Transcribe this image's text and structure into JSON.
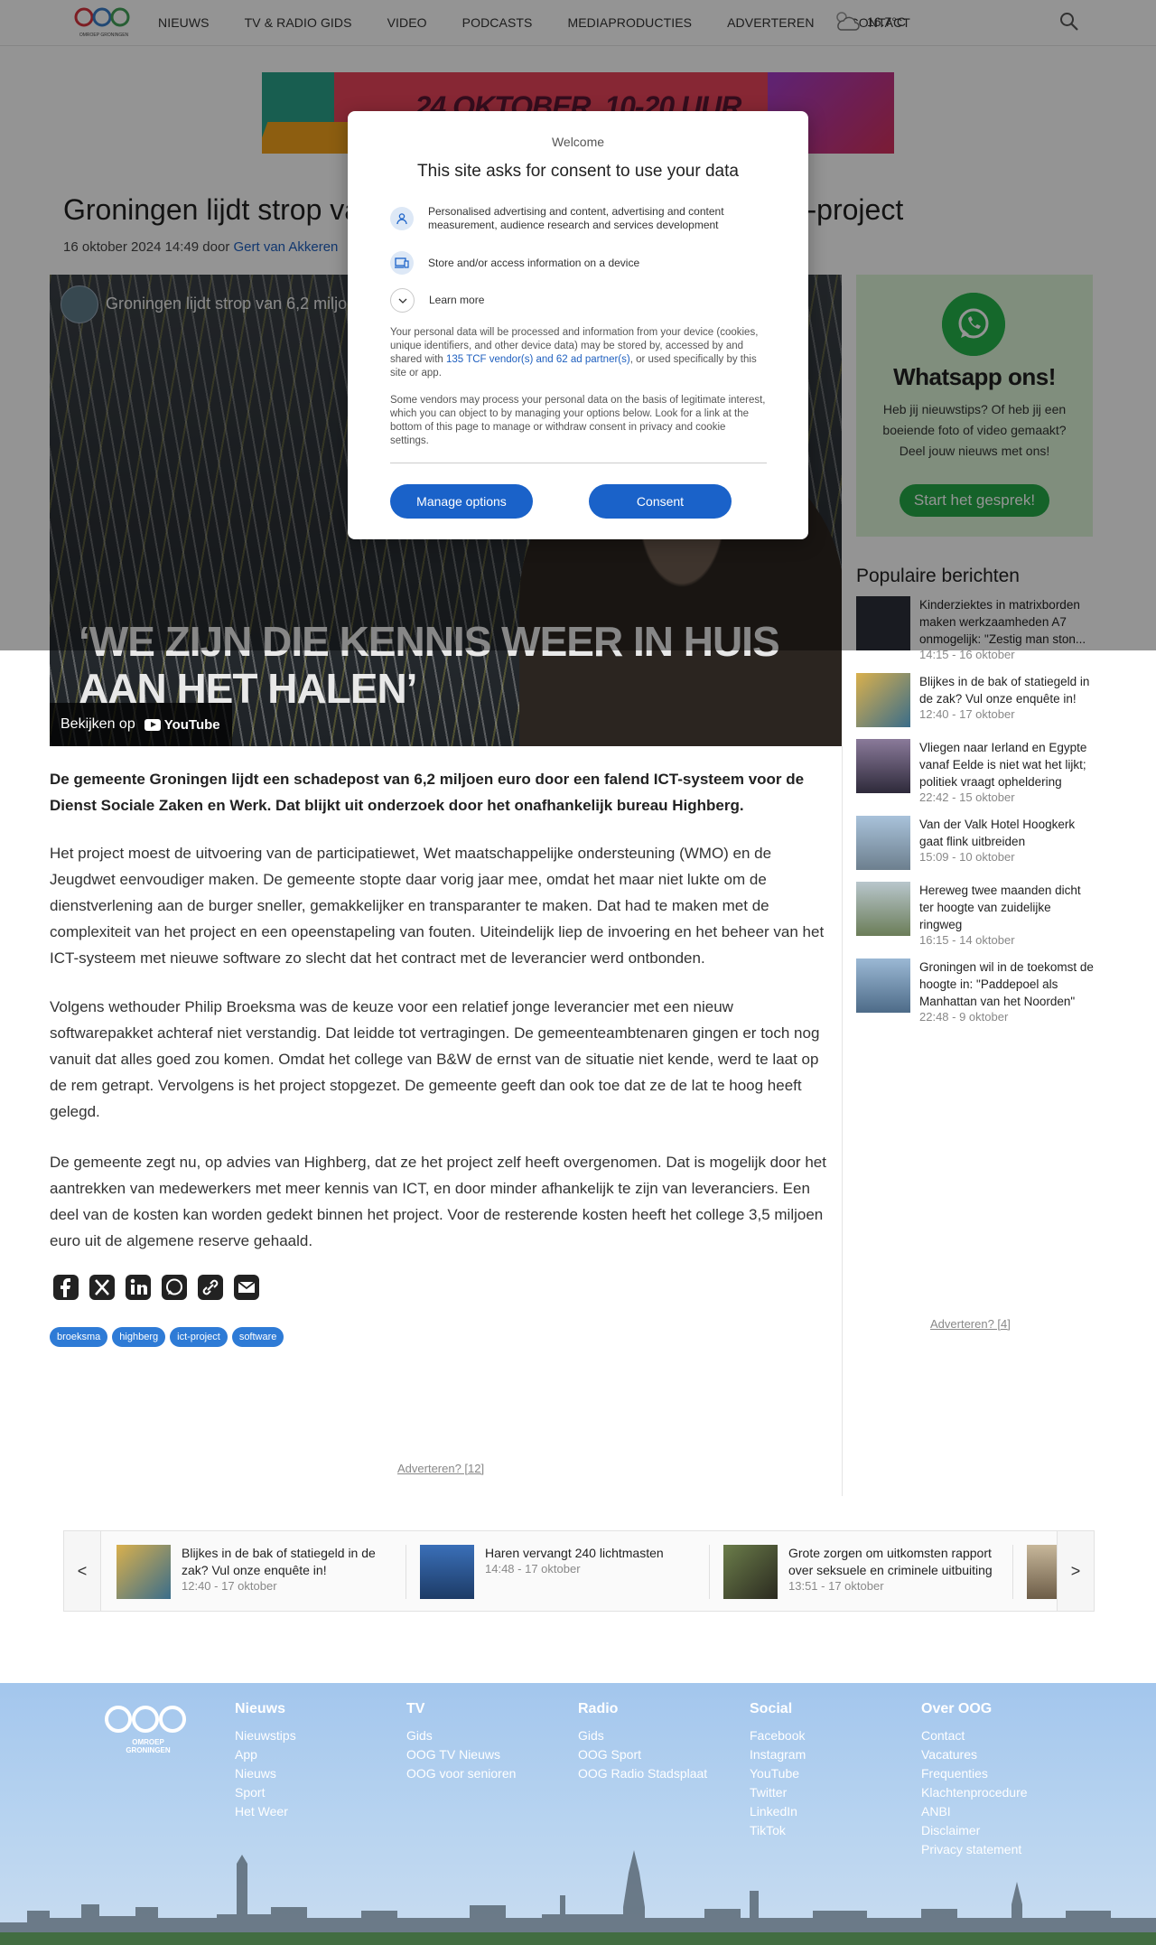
{
  "header": {
    "nav": [
      "NIEUWS",
      "TV & RADIO GIDS",
      "VIDEO",
      "PODCASTS",
      "MEDIAPRODUCTIES",
      "ADVERTEREN",
      "CONTACT"
    ],
    "weather_temp": "16.7°C",
    "logo_text": "OMROEP GRONINGEN"
  },
  "banner": {
    "text": "24 OKTOBER, 10-20 UUR"
  },
  "article": {
    "title": "Groningen lijdt strop van 6,2 miljoen euro door mislukt ICT-project",
    "date": "16 oktober 2024 14:49",
    "by": "door",
    "author": "Gert van Akkeren",
    "video": {
      "title": "Groningen lijdt strop van 6,2 miljoen",
      "quote": "‘WE ZIJN DIE KENNIS WEER IN HUIS AAN HET HALEN’",
      "watch_on": "Bekijken op",
      "yt": "YouTube"
    },
    "lead": "De gemeente Groningen lijdt een schadepost van 6,2 miljoen euro door een falend ICT-systeem voor de Dienst Sociale Zaken en Werk. Dat blijkt uit onderzoek door het onafhankelijk bureau Highberg.",
    "paragraphs": [
      "Het project moest de uitvoering van de participatiewet, Wet maatschappelijke ondersteuning (WMO) en de Jeugdwet eenvoudiger maken. De gemeente stopte daar vorig jaar mee, omdat het maar niet lukte om de dienstverlening aan de burger sneller, gemakkelijker en transparanter te maken. Dat had te maken met de complexiteit van het project en een opeenstapeling van fouten. Uiteindelijk liep de invoering en het beheer van het ICT-systeem met nieuwe software zo slecht dat het contract met de leverancier werd ontbonden.",
      "Volgens wethouder Philip Broeksma was de keuze voor een relatief jonge leverancier met een nieuw softwarepakket achteraf niet verstandig. Dat leidde tot vertragingen. De gemeenteambtenaren gingen er toch nog vanuit dat alles goed zou komen. Omdat het college van B&W de ernst van de situatie niet kende, werd te laat op de rem getrapt. Vervolgens is het project stopgezet. De gemeente geeft dan ook toe dat ze de lat te hoog heeft gelegd.",
      "De gemeente zegt nu, op advies van Highberg, dat ze het project zelf heeft overgenomen. Dat is mogelijk door het aantrekken van medewerkers met meer kennis van ICT, en door minder afhankelijk te zijn van leveranciers. Een deel van de kosten kan worden gedekt binnen het project. Voor de resterende kosten heeft het college 3,5 miljoen euro uit de algemene reserve gehaald."
    ],
    "tags": [
      "broeksma",
      "highberg",
      "ict-project",
      "software"
    ],
    "adv_link": "Adverteren? [12]"
  },
  "sidebar": {
    "whatsapp": {
      "title": "Whatsapp ons!",
      "text": "Heb jij nieuwstips? Of heb jij een boeiende foto of video gemaakt? Deel jouw nieuws met ons!",
      "button": "Start het gesprek!"
    },
    "popular_title": "Populaire berichten",
    "popular": [
      {
        "title": "Kinderziektes in matrixborden maken werkzaamheden A7 onmogelijk: \"Zestig man ston...",
        "time": "14:15 - 16 oktober",
        "thumb": "#2b2f3a"
      },
      {
        "title": "Blijkes in de bak of statiegeld in de zak? Vul onze enquête in!",
        "time": "12:40 - 17 oktober",
        "thumb": "#c9a34a"
      },
      {
        "title": "Vliegen naar Ierland en Egypte vanaf Eelde is niet wat het lijkt; politiek vraagt opheldering",
        "time": "22:42 - 15 oktober",
        "thumb": "#5a4f6e"
      },
      {
        "title": "Van der Valk Hotel Hoogkerk gaat flink uitbreiden",
        "time": "15:09 - 10 oktober",
        "thumb": "#7d93a8"
      },
      {
        "title": "Hereweg twee maanden dicht ter hoogte van zuidelijke ringweg",
        "time": "16:15 - 14 oktober",
        "thumb": "#7a8a6e"
      },
      {
        "title": "Groningen wil in de toekomst de hoogte in: \"Paddepoel als Manhattan van het Noorden\"",
        "time": "22:48 - 9 oktober",
        "thumb": "#4d6b88"
      }
    ],
    "adv_link": "Adverteren? [4]"
  },
  "carousel": {
    "prev": "<",
    "next": ">",
    "items": [
      {
        "title": "Blijkes in de bak of statiegeld in de zak? Vul onze enquête in!",
        "time": "12:40 - 17 oktober",
        "thumb": "#c9a34a"
      },
      {
        "title": "Haren vervangt 240 lichtmasten",
        "time": "14:48 - 17 oktober",
        "thumb": "#2e5a9a"
      },
      {
        "title": "Grote zorgen om uitkomsten rapport over seksuele en criminele uitbuiting",
        "time": "13:51 - 17 oktober",
        "thumb": "#4a5d3a"
      }
    ]
  },
  "footer": {
    "logo_text": "OMROEP GRONINGEN",
    "columns": [
      {
        "title": "Nieuws",
        "links": [
          "Nieuwstips",
          "App",
          "Nieuws",
          "Sport",
          "Het Weer"
        ]
      },
      {
        "title": "TV",
        "links": [
          "Gids",
          "OOG TV Nieuws",
          "OOG voor senioren"
        ]
      },
      {
        "title": "Radio",
        "links": [
          "Gids",
          "OOG Sport",
          "OOG Radio Stadsplaat"
        ]
      },
      {
        "title": "Social",
        "links": [
          "Facebook",
          "Instagram",
          "YouTube",
          "Twitter",
          "LinkedIn",
          "TikTok"
        ]
      },
      {
        "title": "Over OOG",
        "links": [
          "Contact",
          "Vacatures",
          "Frequenties",
          "Klachtenprocedure",
          "ANBI",
          "Disclaimer",
          "Privacy statement"
        ]
      }
    ]
  },
  "consent": {
    "welcome": "Welcome",
    "title": "This site asks for consent to use your data",
    "purposes": [
      "Personalised advertising and content, advertising and content measurement, audience research and services development",
      "Store and/or access information on a device",
      "Learn more"
    ],
    "text1_a": "Your personal data will be processed and information from your device (cookies, unique identifiers, and other device data) may be stored by, accessed by and shared with ",
    "text1_link": "135 TCF vendor(s) and 62 ad partner(s)",
    "text1_b": ", or used specifically by this site or app.",
    "text2": "Some vendors may process your personal data on the basis of legitimate interest, which you can object to by managing your options below. Look for a link at the bottom of this page to manage or withdraw consent in privacy and cookie settings.",
    "manage_button": "Manage options",
    "consent_button": "Consent"
  },
  "colors": {
    "accent": "#1a62c9",
    "tag": "#2e7bd6",
    "whatsapp": "#25b34a",
    "footer": "#a3c6ed"
  }
}
